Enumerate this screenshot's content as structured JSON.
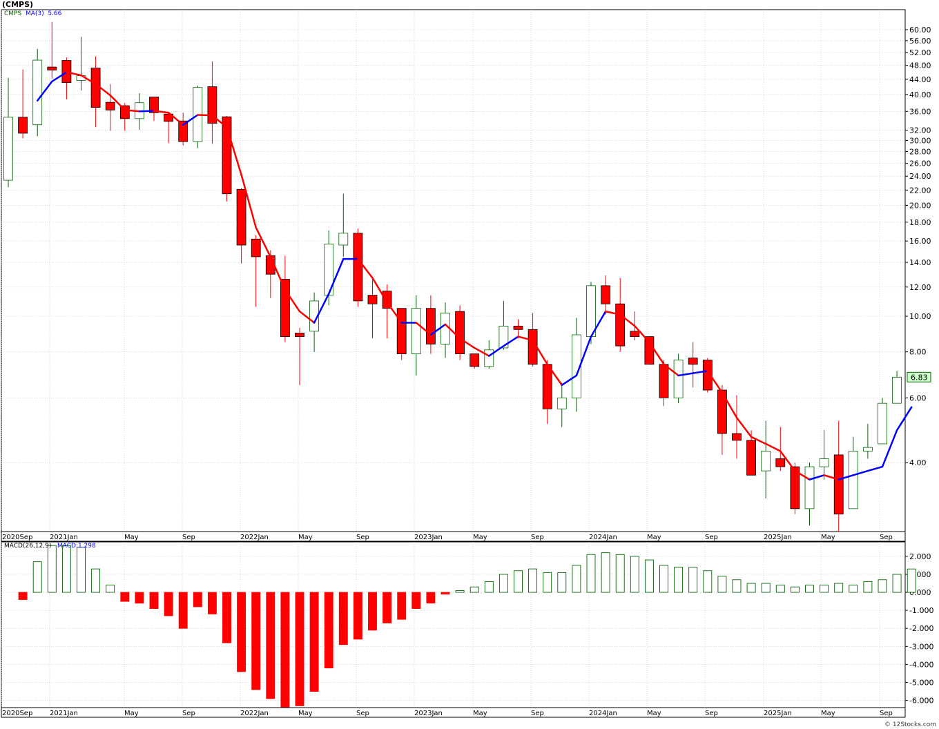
{
  "header": {
    "title": "(CMPS)"
  },
  "legend": {
    "symbol": "CMPS",
    "ma_label": "MA(3)",
    "ma_value": "5.66",
    "macd_label": "MACD(26,12,9)",
    "macd_value": "MACD:1.298"
  },
  "last_price_label": "6.83",
  "watermark": "© 12Stocks.com",
  "colors": {
    "up": "#006400",
    "down": "#ff0000",
    "ma_up": "#0000ff",
    "ma_down": "#ff0000",
    "grid": "#bbbbbb"
  },
  "chart_data": [
    {
      "type": "candlestick",
      "title": "(CMPS)",
      "scale": "log",
      "y_ticks": [
        "60.00",
        "56.00",
        "52.00",
        "48.00",
        "44.00",
        "40.00",
        "36.00",
        "32.00",
        "30.00",
        "28.00",
        "26.00",
        "24.00",
        "22.00",
        "20.00",
        "18.00",
        "16.00",
        "14.00",
        "12.00",
        "10.00",
        "8.00",
        "6.00",
        "4.00"
      ],
      "ylim": [
        2.6,
        68
      ],
      "x_labels": [
        "2020Sep",
        "2021Jan",
        "May",
        "Sep",
        "2022Jan",
        "May",
        "Sep",
        "2023Jan",
        "May",
        "Sep",
        "2024Jan",
        "May",
        "Sep",
        "2025Jan",
        "May",
        "Sep"
      ],
      "series": [
        {
          "name": "CMPS",
          "candles": [
            {
              "o": 23.4,
              "h": 44.4,
              "l": 22.4,
              "c": 34.7
            },
            {
              "o": 34.7,
              "h": 46.8,
              "l": 30.4,
              "c": 31.4
            },
            {
              "o": 33.1,
              "h": 53.2,
              "l": 30.8,
              "c": 49.6
            },
            {
              "o": 47.5,
              "h": 63.0,
              "l": 44.2,
              "c": 46.6
            },
            {
              "o": 49.5,
              "h": 50.4,
              "l": 38.8,
              "c": 43.1
            },
            {
              "o": 43.7,
              "h": 57.4,
              "l": 41.0,
              "c": 45.0
            },
            {
              "o": 47.2,
              "h": 50.8,
              "l": 32.6,
              "c": 36.9
            },
            {
              "o": 38.1,
              "h": 42.7,
              "l": 31.9,
              "c": 36.3
            },
            {
              "o": 37.3,
              "h": 37.9,
              "l": 31.9,
              "c": 34.4
            },
            {
              "o": 34.4,
              "h": 40.3,
              "l": 32.1,
              "c": 38.0
            },
            {
              "o": 39.4,
              "h": 39.4,
              "l": 33.9,
              "c": 35.7
            },
            {
              "o": 35.4,
              "h": 35.7,
              "l": 29.5,
              "c": 33.8
            },
            {
              "o": 33.9,
              "h": 35.7,
              "l": 29.1,
              "c": 29.8
            },
            {
              "o": 29.8,
              "h": 42.3,
              "l": 28.6,
              "c": 41.8
            },
            {
              "o": 42.0,
              "h": 49.2,
              "l": 29.4,
              "c": 33.4
            },
            {
              "o": 34.8,
              "h": 35.0,
              "l": 20.5,
              "c": 21.5
            },
            {
              "o": 22.1,
              "h": 22.3,
              "l": 13.9,
              "c": 15.6
            },
            {
              "o": 16.2,
              "h": 16.6,
              "l": 10.6,
              "c": 14.5
            },
            {
              "o": 14.6,
              "h": 15.1,
              "l": 11.2,
              "c": 13.0
            },
            {
              "o": 12.6,
              "h": 14.6,
              "l": 8.5,
              "c": 8.8
            },
            {
              "o": 9.0,
              "h": 9.3,
              "l": 6.5,
              "c": 8.8
            },
            {
              "o": 9.1,
              "h": 11.6,
              "l": 8.0,
              "c": 11.0
            },
            {
              "o": 11.4,
              "h": 17.1,
              "l": 10.7,
              "c": 15.7
            },
            {
              "o": 15.6,
              "h": 21.5,
              "l": 14.5,
              "c": 16.8
            },
            {
              "o": 16.8,
              "h": 17.3,
              "l": 10.6,
              "c": 11.0
            },
            {
              "o": 11.4,
              "h": 12.6,
              "l": 8.7,
              "c": 10.8
            },
            {
              "o": 11.7,
              "h": 12.2,
              "l": 8.7,
              "c": 10.5
            },
            {
              "o": 10.5,
              "h": 10.5,
              "l": 7.6,
              "c": 7.9
            },
            {
              "o": 7.9,
              "h": 11.4,
              "l": 6.9,
              "c": 10.5
            },
            {
              "o": 10.5,
              "h": 11.4,
              "l": 7.9,
              "c": 8.4
            },
            {
              "o": 8.4,
              "h": 10.9,
              "l": 7.7,
              "c": 10.2
            },
            {
              "o": 10.3,
              "h": 10.7,
              "l": 7.6,
              "c": 7.9
            },
            {
              "o": 7.9,
              "h": 7.9,
              "l": 7.2,
              "c": 7.3
            },
            {
              "o": 7.3,
              "h": 8.6,
              "l": 7.2,
              "c": 8.1
            },
            {
              "o": 8.2,
              "h": 11.0,
              "l": 8.1,
              "c": 9.4
            },
            {
              "o": 9.4,
              "h": 9.8,
              "l": 8.7,
              "c": 9.2
            },
            {
              "o": 9.2,
              "h": 10.2,
              "l": 7.3,
              "c": 7.4
            },
            {
              "o": 7.4,
              "h": 7.6,
              "l": 5.1,
              "c": 5.6
            },
            {
              "o": 5.6,
              "h": 6.6,
              "l": 5.0,
              "c": 6.0
            },
            {
              "o": 6.0,
              "h": 9.9,
              "l": 5.5,
              "c": 8.9
            },
            {
              "o": 8.8,
              "h": 12.4,
              "l": 8.4,
              "c": 12.1
            },
            {
              "o": 12.1,
              "h": 12.9,
              "l": 10.1,
              "c": 10.8
            },
            {
              "o": 10.8,
              "h": 12.7,
              "l": 8.0,
              "c": 8.3
            },
            {
              "o": 9.1,
              "h": 10.3,
              "l": 8.6,
              "c": 8.8
            },
            {
              "o": 8.8,
              "h": 8.8,
              "l": 7.4,
              "c": 7.4
            },
            {
              "o": 7.4,
              "h": 7.6,
              "l": 5.7,
              "c": 6.0
            },
            {
              "o": 6.0,
              "h": 7.9,
              "l": 5.8,
              "c": 7.6
            },
            {
              "o": 7.7,
              "h": 8.5,
              "l": 6.4,
              "c": 7.4
            },
            {
              "o": 7.6,
              "h": 7.7,
              "l": 6.2,
              "c": 6.3
            },
            {
              "o": 6.3,
              "h": 6.5,
              "l": 4.2,
              "c": 4.8
            },
            {
              "o": 4.8,
              "h": 6.1,
              "l": 4.1,
              "c": 4.6
            },
            {
              "o": 4.6,
              "h": 4.9,
              "l": 3.7,
              "c": 3.7
            },
            {
              "o": 3.8,
              "h": 5.2,
              "l": 3.2,
              "c": 4.3
            },
            {
              "o": 4.1,
              "h": 5.0,
              "l": 3.8,
              "c": 3.9
            },
            {
              "o": 3.9,
              "h": 4.0,
              "l": 2.9,
              "c": 3.0
            },
            {
              "o": 3.0,
              "h": 4.0,
              "l": 2.7,
              "c": 3.9
            },
            {
              "o": 3.9,
              "h": 4.9,
              "l": 3.6,
              "c": 4.1
            },
            {
              "o": 4.2,
              "h": 5.2,
              "l": 2.6,
              "c": 2.9
            },
            {
              "o": 3.0,
              "h": 4.7,
              "l": 3.0,
              "c": 4.3
            },
            {
              "o": 4.3,
              "h": 5.1,
              "l": 4.1,
              "c": 4.4
            },
            {
              "o": 4.5,
              "h": 6.0,
              "l": 4.5,
              "c": 5.8
            },
            {
              "o": 5.8,
              "h": 7.1,
              "l": 5.8,
              "c": 6.83
            }
          ]
        },
        {
          "name": "MA(3)",
          "values": [
            null,
            null,
            38.5,
            43.4,
            46.0,
            45.1,
            42.7,
            39.8,
            36.3,
            36.0,
            36.1,
            35.7,
            33.1,
            35.2,
            35.1,
            32.6,
            24.2,
            17.4,
            14.5,
            11.8,
            10.3,
            9.6,
            11.5,
            14.3,
            14.3,
            12.7,
            10.9,
            9.6,
            9.6,
            8.9,
            9.5,
            8.7,
            8.2,
            7.8,
            8.3,
            8.8,
            8.6,
            7.4,
            6.5,
            6.9,
            8.8,
            10.3,
            10.1,
            9.4,
            8.5,
            7.4,
            6.9,
            7.0,
            7.1,
            6.2,
            5.3,
            4.7,
            4.5,
            4.3,
            3.8,
            3.6,
            3.7,
            3.6,
            3.7,
            3.8,
            3.9,
            4.9,
            5.66
          ]
        }
      ]
    },
    {
      "type": "bar",
      "title": "MACD(26,12,9)",
      "y_ticks": [
        "2.000",
        "1.000",
        "0.000",
        "-1.000",
        "-2.000",
        "-3.000",
        "-4.000",
        "-5.000",
        "-6.000"
      ],
      "ylim": [
        -6.4,
        2.8
      ],
      "x_labels": [
        "2020Sep",
        "2021Jan",
        "May",
        "Sep",
        "2022Jan",
        "May",
        "Sep",
        "2023Jan",
        "May",
        "Sep",
        "2024Jan",
        "May",
        "Sep",
        "2025Jan",
        "May",
        "Sep"
      ],
      "series": [
        {
          "name": "MACD",
          "values": [
            -0.4,
            1.7,
            2.6,
            2.6,
            2.5,
            1.3,
            0.4,
            -0.5,
            -0.6,
            -0.9,
            -1.3,
            -2.0,
            -0.8,
            -1.2,
            -2.8,
            -4.4,
            -5.4,
            -5.9,
            -6.5,
            -6.3,
            -5.5,
            -4.2,
            -2.9,
            -2.6,
            -2.1,
            -1.7,
            -1.5,
            -0.9,
            -0.6,
            -0.1,
            0.1,
            0.3,
            0.6,
            1.0,
            1.2,
            1.3,
            1.1,
            1.1,
            1.5,
            2.1,
            2.2,
            2.1,
            2.0,
            1.8,
            1.5,
            1.4,
            1.4,
            1.2,
            0.9,
            0.7,
            0.5,
            0.5,
            0.4,
            0.3,
            0.4,
            0.4,
            0.5,
            0.4,
            0.6,
            0.7,
            1.0,
            1.298
          ]
        }
      ]
    }
  ]
}
